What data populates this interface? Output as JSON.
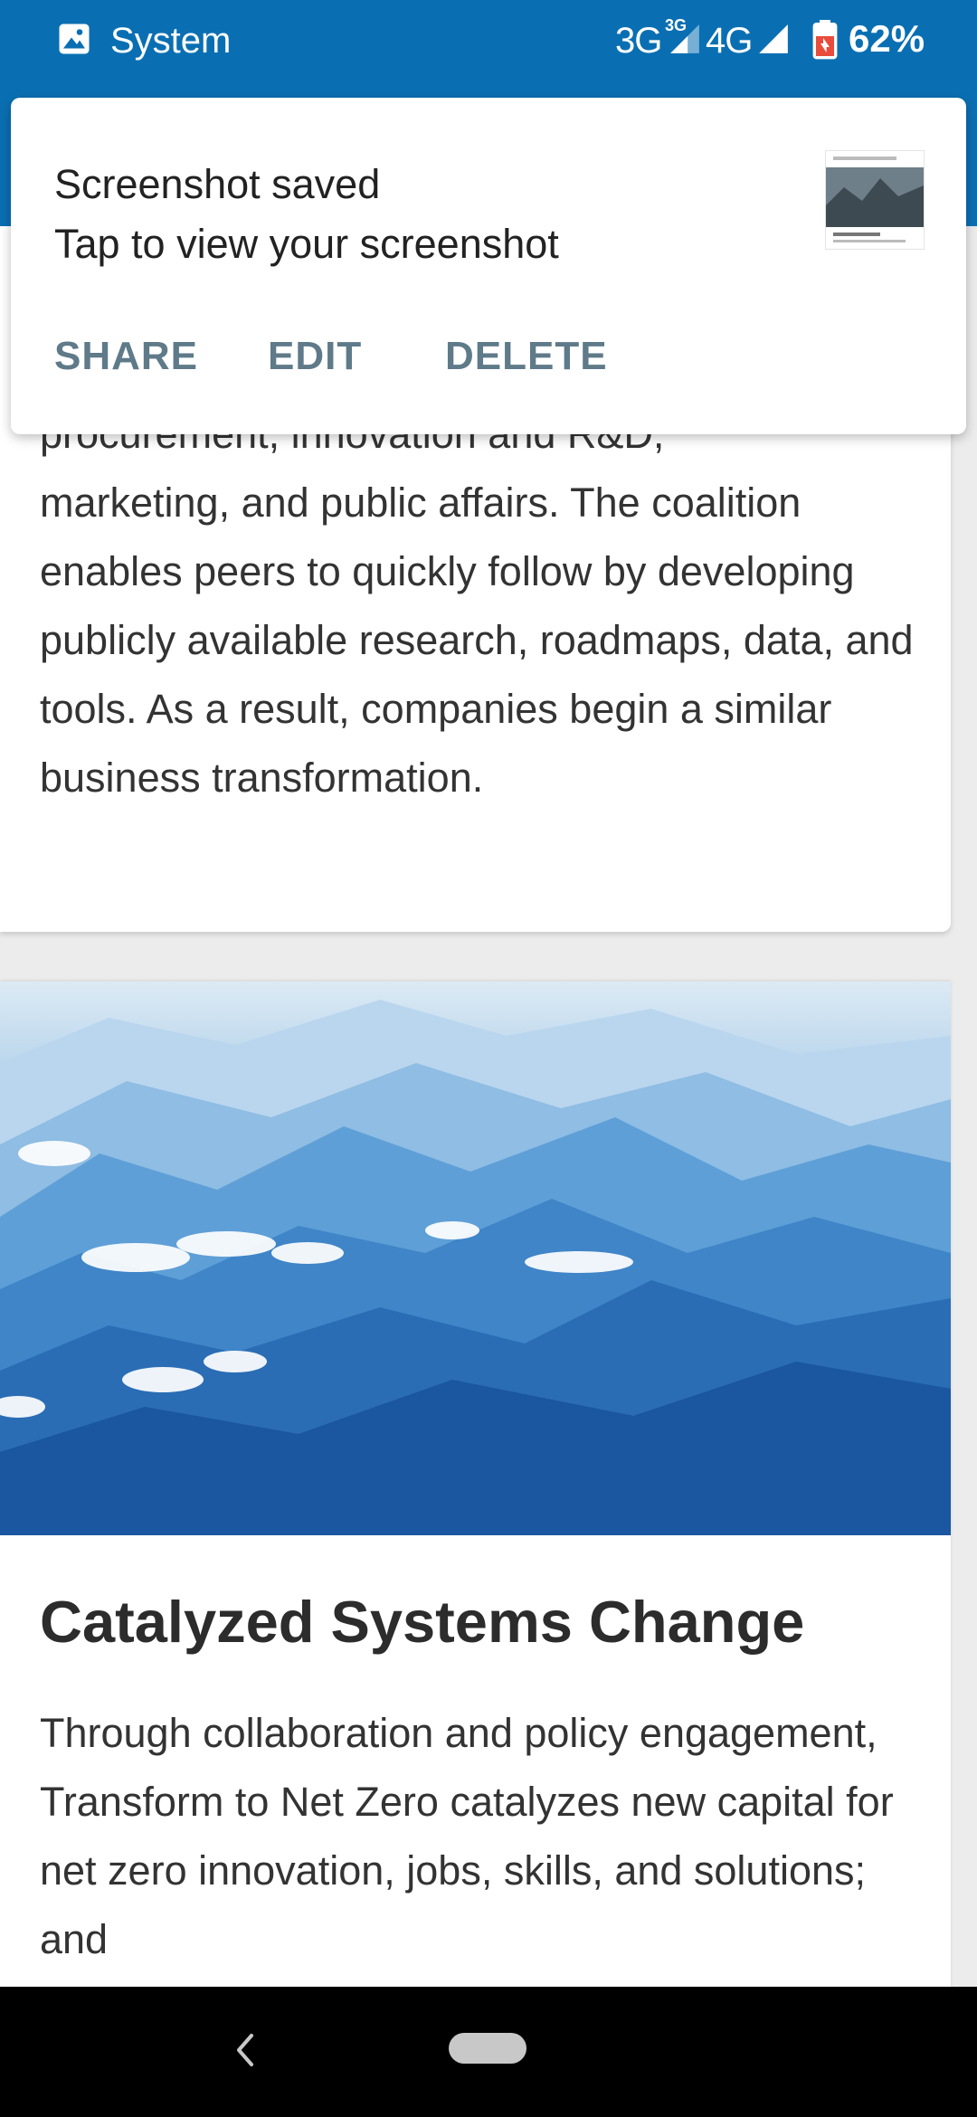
{
  "status_bar": {
    "app_name": "System",
    "network_3g": "3G",
    "network_3g_sup": "3G",
    "network_4g": "4G",
    "battery_percent": "62%",
    "icons": [
      "image-icon",
      "signal-icon",
      "signal-icon",
      "battery-icon"
    ]
  },
  "notification": {
    "title": "Screenshot saved",
    "text": "Tap to view your screenshot",
    "actions": {
      "share": "SHARE",
      "edit": "EDIT",
      "delete": "DELETE"
    },
    "accent_color": "#5f7a89"
  },
  "card1": {
    "partial_line": "procurement, innovation and R&D,",
    "body": "marketing, and public affairs. The coalition enables peers to quickly follow by developing publicly available research, roadmaps, data, and tools. As a result, companies begin a similar business transformation."
  },
  "card2": {
    "image": "mountains-image",
    "title": "Catalyzed Systems Change",
    "body": "Through collaboration and policy engagement, Transform to Net Zero catalyzes new capital for net zero innovation, jobs, skills, and solutions; and"
  },
  "navigation_bar": {
    "icons": [
      "back-icon",
      "home-icon"
    ]
  },
  "colors": {
    "header_blue": "#0a6fb2",
    "text": "#333333"
  }
}
